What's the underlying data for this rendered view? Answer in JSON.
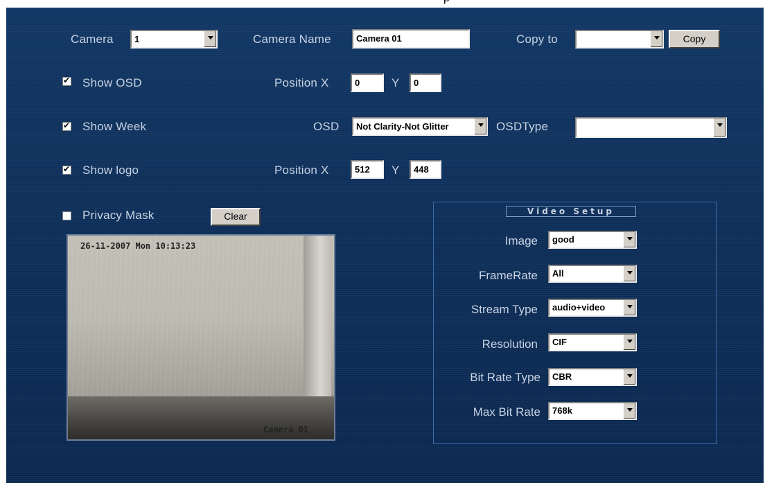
{
  "top": {
    "glyph": "p"
  },
  "camera": {
    "label": "Camera",
    "value": "1"
  },
  "camera_name": {
    "label": "Camera Name",
    "value": "Camera 01"
  },
  "copy_to": {
    "label": "Copy to",
    "value": "",
    "button": "Copy"
  },
  "show_osd": {
    "label": "Show OSD",
    "checked": true
  },
  "osd_position": {
    "label_x": "Position X",
    "x": "0",
    "label_y": "Y",
    "y": "0"
  },
  "show_week": {
    "label": "Show Week",
    "checked": true
  },
  "osd": {
    "label": "OSD",
    "value": "Not Clarity-Not Glitter"
  },
  "osd_type": {
    "label": "OSDType",
    "value": ""
  },
  "show_logo": {
    "label": "Show logo",
    "checked": true
  },
  "logo_position": {
    "label_x": "Position X",
    "x": "512",
    "label_y": "Y",
    "y": "448"
  },
  "privacy_mask": {
    "label": "Privacy Mask",
    "checked": false,
    "clear_button": "Clear"
  },
  "video_preview": {
    "timestamp": "26-11-2007 Mon 10:13:23",
    "caption": "Camera 01"
  },
  "video_setup": {
    "title": "Video Setup",
    "image": {
      "label": "Image",
      "value": "good"
    },
    "frame_rate": {
      "label": "FrameRate",
      "value": "All"
    },
    "stream_type": {
      "label": "Stream Type",
      "value": "audio+video"
    },
    "resolution": {
      "label": "Resolution",
      "value": "CIF"
    },
    "bit_rate_type": {
      "label": "Bit Rate Type",
      "value": "CBR"
    },
    "max_bit_rate": {
      "label": "Max Bit Rate",
      "value": "768k"
    }
  },
  "colors": {
    "panel_bg": "#123765",
    "label": "#c9d3e3",
    "group_border": "#3e6eab"
  }
}
